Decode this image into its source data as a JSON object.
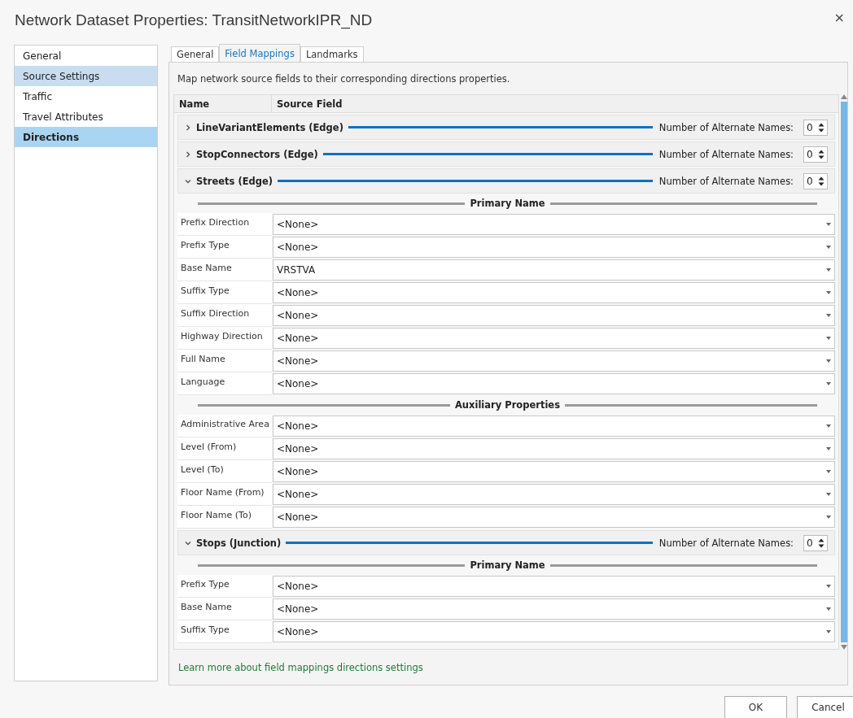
{
  "window": {
    "title": "Network Dataset Properties: TransitNetworkIPR_ND",
    "close": "×"
  },
  "sidebar": {
    "items": [
      {
        "label": "General",
        "selected": false,
        "hovered": false
      },
      {
        "label": "Source Settings",
        "selected": false,
        "hovered": true
      },
      {
        "label": "Traffic",
        "selected": false,
        "hovered": false
      },
      {
        "label": "Travel Attributes",
        "selected": false,
        "hovered": false
      },
      {
        "label": "Directions",
        "selected": true,
        "hovered": false
      }
    ]
  },
  "tabs": [
    {
      "label": "General",
      "selected": false
    },
    {
      "label": "Field Mappings",
      "selected": true
    },
    {
      "label": "Landmarks",
      "selected": false
    }
  ],
  "description": "Map network source fields to their corresponding directions properties.",
  "table": {
    "columns": [
      "Name",
      "Source Field"
    ],
    "sources": [
      {
        "name": "LineVariantElements (Edge)",
        "expanded": false,
        "alternate_label": "Number of Alternate Names:",
        "alternate_count": "0"
      },
      {
        "name": "StopConnectors (Edge)",
        "expanded": false,
        "alternate_label": "Number of Alternate Names:",
        "alternate_count": "0"
      },
      {
        "name": "Streets (Edge)",
        "expanded": true,
        "alternate_label": "Number of Alternate Names:",
        "alternate_count": "0",
        "sections": [
          {
            "title": "Primary Name",
            "rows": [
              {
                "label": "Prefix Direction",
                "value": "<None>"
              },
              {
                "label": "Prefix Type",
                "value": "<None>"
              },
              {
                "label": "Base Name",
                "value": "VRSTVA"
              },
              {
                "label": "Suffix Type",
                "value": "<None>"
              },
              {
                "label": "Suffix Direction",
                "value": "<None>"
              },
              {
                "label": "Highway Direction",
                "value": "<None>"
              },
              {
                "label": "Full Name",
                "value": "<None>"
              },
              {
                "label": "Language",
                "value": "<None>"
              }
            ]
          },
          {
            "title": "Auxiliary Properties",
            "rows": [
              {
                "label": "Administrative Area",
                "value": "<None>"
              },
              {
                "label": "Level (From)",
                "value": "<None>"
              },
              {
                "label": "Level (To)",
                "value": "<None>"
              },
              {
                "label": "Floor Name (From)",
                "value": "<None>"
              },
              {
                "label": "Floor Name (To)",
                "value": "<None>"
              }
            ]
          }
        ]
      },
      {
        "name": "Stops (Junction)",
        "expanded": true,
        "alternate_label": "Number of Alternate Names:",
        "alternate_count": "0",
        "sections": [
          {
            "title": "Primary Name",
            "rows": [
              {
                "label": "Prefix Type",
                "value": "<None>"
              },
              {
                "label": "Base Name",
                "value": "<None>"
              },
              {
                "label": "Suffix Type",
                "value": "<None>"
              }
            ]
          }
        ]
      }
    ]
  },
  "link": "Learn more about field mappings directions settings",
  "buttons": [
    "OK",
    "Cancel"
  ]
}
